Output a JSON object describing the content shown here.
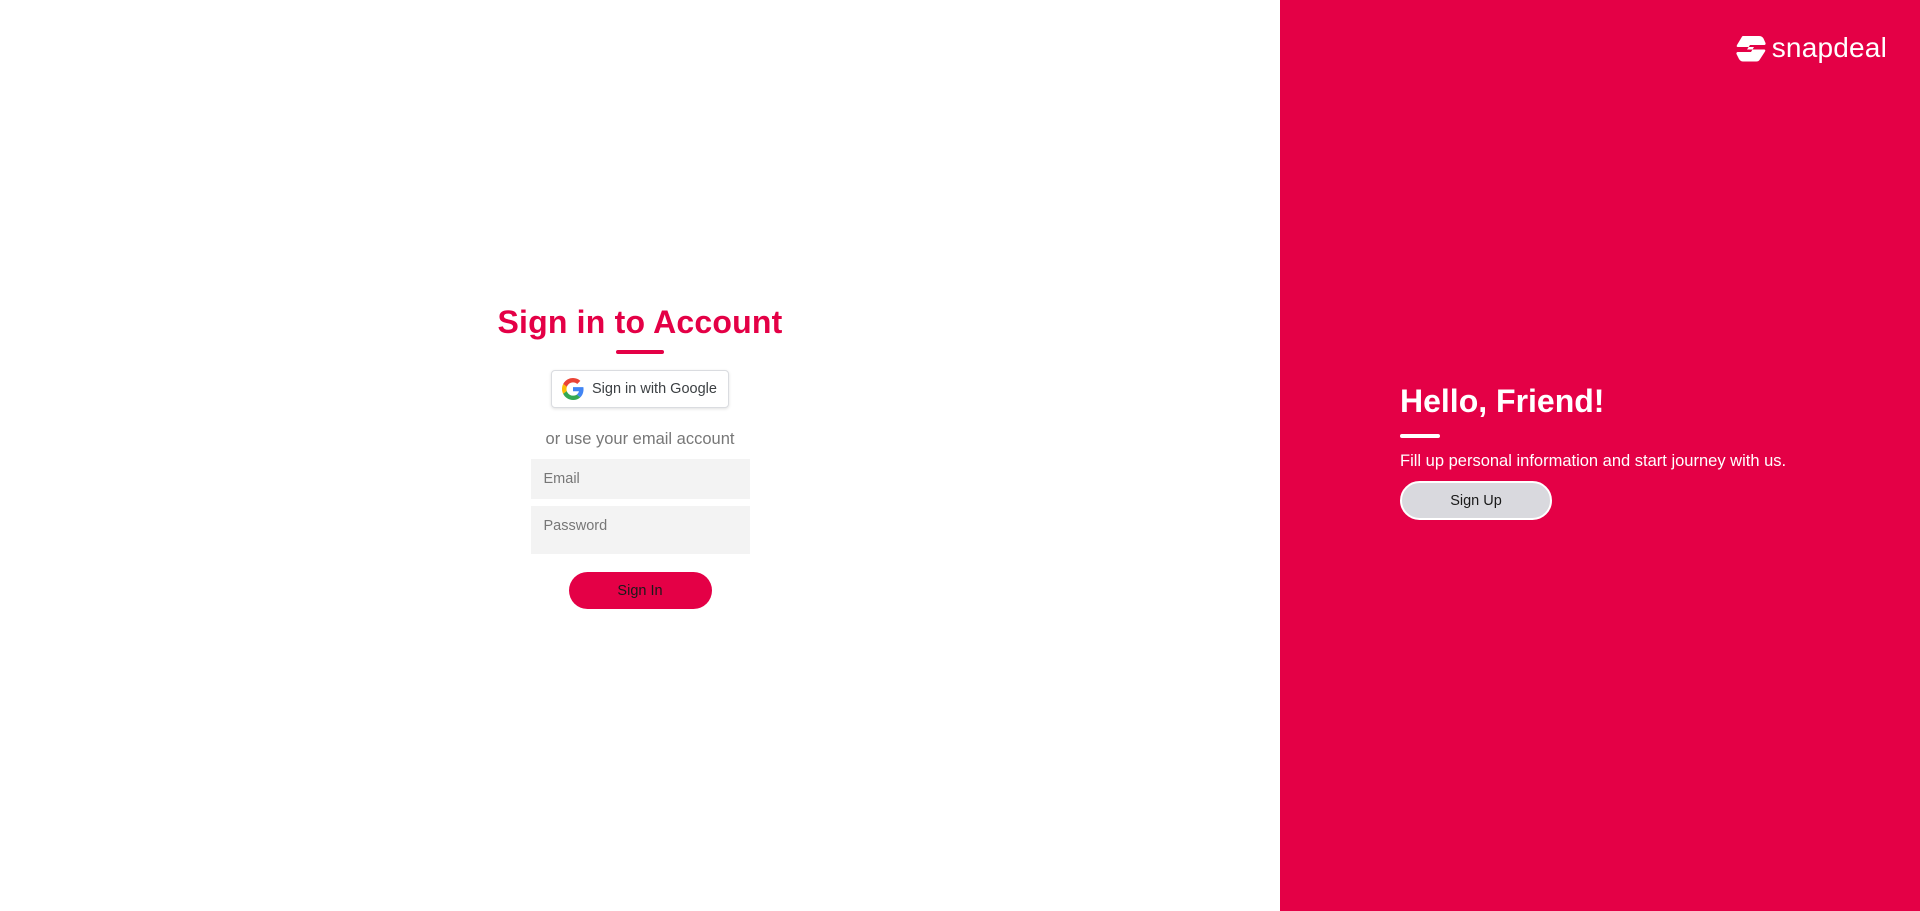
{
  "signin": {
    "title": "Sign in to Account",
    "google_button_label": "Sign in with Google",
    "alt_text": "or use your email account",
    "email_placeholder": "Email",
    "password_placeholder": "Password",
    "submit_label": "Sign In"
  },
  "promo": {
    "logo_text": "snapdeal",
    "title": "Hello, Friend!",
    "text": "Fill up personal information and start journey with us.",
    "signup_label": "Sign Up"
  },
  "colors": {
    "brand": "#e40046",
    "input_bg": "#f3f3f3",
    "signup_bg": "#d9d9de"
  },
  "icons": {
    "google": "google-g-logo-icon",
    "logo": "snapdeal-logo-icon"
  }
}
